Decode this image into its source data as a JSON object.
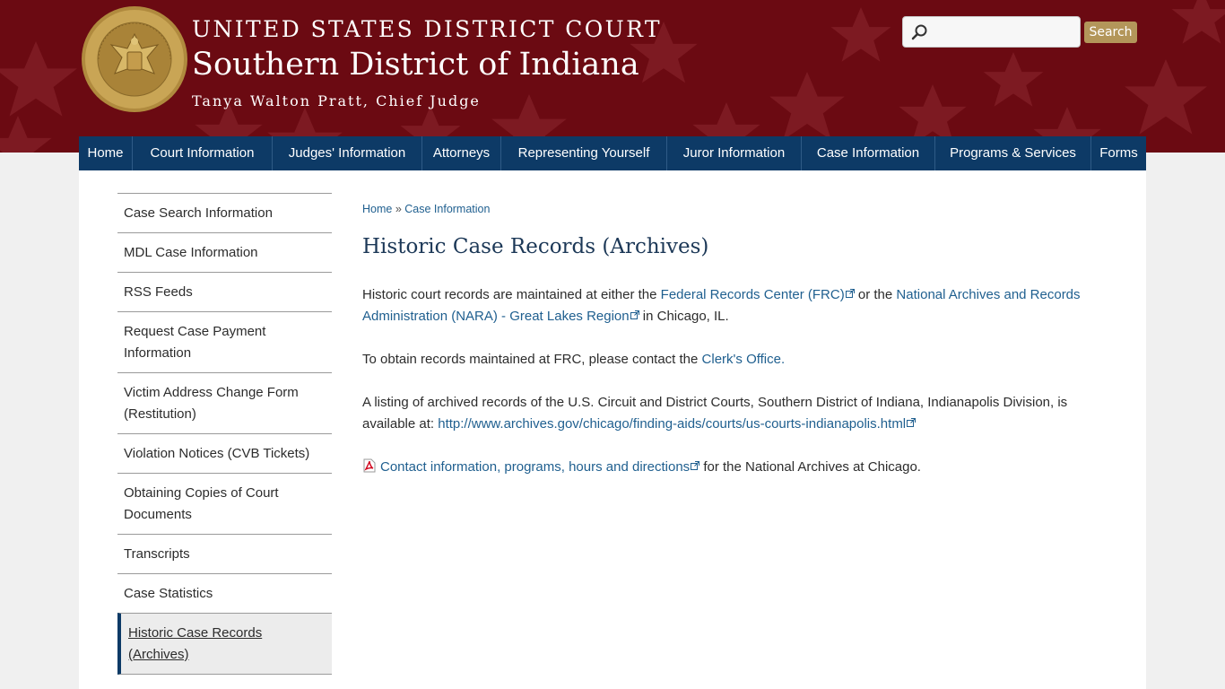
{
  "header": {
    "line1": "UNITED STATES DISTRICT COURT",
    "line2": "Southern District of Indiana",
    "line3": "Tanya Walton Pratt, Chief Judge",
    "seal_text": "UNITED STATES DISTRICT COURT SOUTHERN DISTRICT OF INDIANA",
    "search_placeholder": "",
    "search_button": "Search",
    "brand_color": "#6b0a12",
    "accent_color": "#b3965a"
  },
  "nav": {
    "items": [
      {
        "label": "Home"
      },
      {
        "label": "Court Information"
      },
      {
        "label": "Judges' Information"
      },
      {
        "label": "Attorneys"
      },
      {
        "label": "Representing Yourself"
      },
      {
        "label": "Juror Information"
      },
      {
        "label": "Case Information"
      },
      {
        "label": "Programs & Services"
      },
      {
        "label": "Forms"
      }
    ],
    "color": "#0d3a66"
  },
  "sidebar": {
    "items": [
      {
        "label": "Case Search Information"
      },
      {
        "label": "MDL Case Information"
      },
      {
        "label": "RSS Feeds"
      },
      {
        "label": "Request Case Payment Information"
      },
      {
        "label": "Victim Address Change Form (Restitution)"
      },
      {
        "label": "Violation Notices (CVB Tickets)"
      },
      {
        "label": "Obtaining Copies of Court Documents"
      },
      {
        "label": "Transcripts"
      },
      {
        "label": "Case Statistics"
      },
      {
        "label": "Historic Case Records (Archives)",
        "active": true
      }
    ]
  },
  "breadcrumb": {
    "home": "Home",
    "separator": "»",
    "current": "Case Information"
  },
  "page": {
    "title": "Historic Case Records (Archives)",
    "p1_text1": "Historic court records are maintained at either the ",
    "p1_link1": "Federal Records Center (FRC)",
    "p1_text2": " or the ",
    "p1_link2": "National Archives and Records Administration (NARA) - Great Lakes Region",
    "p1_text3": " in Chicago, IL.",
    "p2_text1": "To obtain records maintained at FRC, please contact the ",
    "p2_link": "Clerk's Office.",
    "p3_text1": "A listing of archived records of the U.S. Circuit and District Courts, Southern District of Indiana, Indianapolis Division, is available at:  ",
    "p3_link": "http://www.archives.gov/chicago/finding-aids/courts/us-courts-indianapolis.html",
    "p4_link": "Contact information, programs, hours and directions",
    "p4_text": " for the National Archives at Chicago."
  }
}
